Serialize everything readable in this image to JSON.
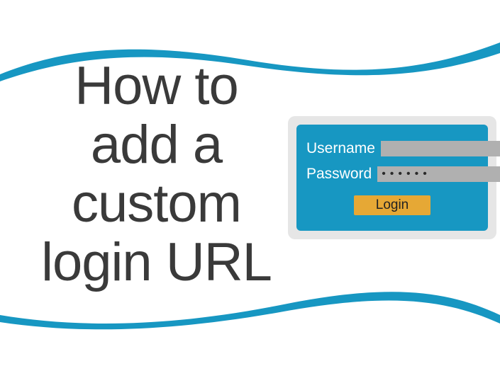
{
  "title": "How to add a custom login URL",
  "login_form": {
    "username_label": "Username",
    "username_value": "",
    "password_label": "Password",
    "password_value": "••••••",
    "login_button": "Login"
  },
  "colors": {
    "accent": "#1797c2",
    "button": "#e6a835",
    "card_bg": "#e6e6e6",
    "title": "#3a3a3a"
  }
}
